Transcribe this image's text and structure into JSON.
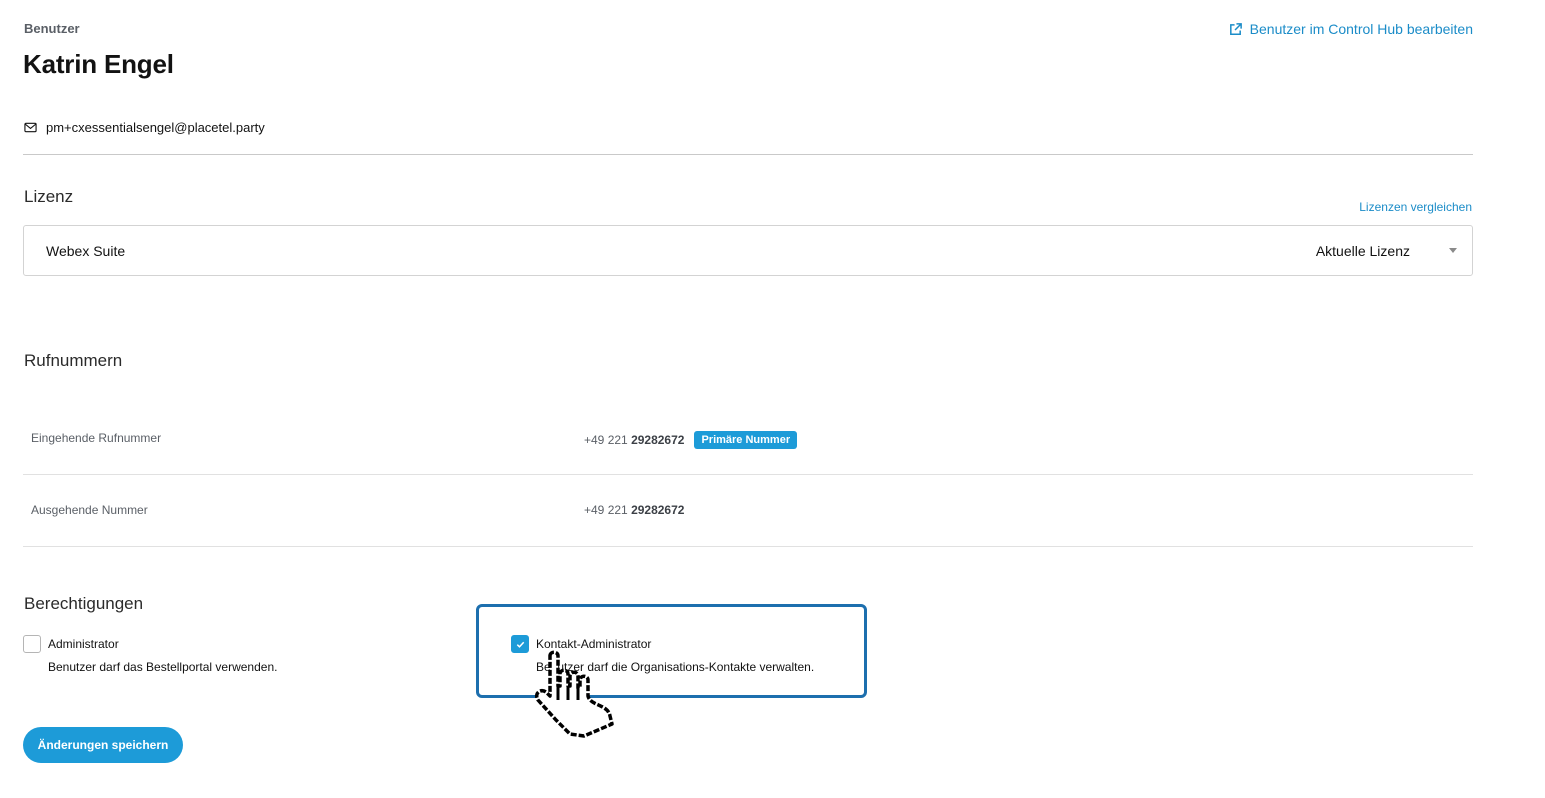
{
  "header": {
    "breadcrumb": "Benutzer",
    "edit_link": "Benutzer im Control Hub bearbeiten",
    "title": "Katrin Engel",
    "email": "pm+cxessentialsengel@placetel.party"
  },
  "license": {
    "section_title": "Lizenz",
    "compare_link": "Lizenzen vergleichen",
    "selected_name": "Webex Suite",
    "selected_status": "Aktuelle Lizenz"
  },
  "numbers": {
    "section_title": "Rufnummern",
    "rows": [
      {
        "label": "Eingehende Rufnummer",
        "prefix": "+49 221",
        "number": "29282672",
        "badge": "Primäre Nummer"
      },
      {
        "label": "Ausgehende Nummer",
        "prefix": "+49 221",
        "number": "29282672"
      }
    ]
  },
  "permissions": {
    "section_title": "Berechtigungen",
    "items": [
      {
        "label": "Administrator",
        "description": "Benutzer darf das Bestellportal verwenden.",
        "checked": false
      },
      {
        "label": "Kontakt-Administrator",
        "description": "Benutzer darf die Organisations-Kontakte verwalten.",
        "checked": true
      }
    ]
  },
  "actions": {
    "save_label": "Änderungen speichern"
  },
  "colors": {
    "accent": "#1d9bd8",
    "link": "#1b8cc8",
    "highlight": "#1d6fae"
  },
  "icons": [
    "external-link-icon",
    "mail-icon",
    "caret-down-icon",
    "check-icon",
    "hand-pointer-icon"
  ]
}
